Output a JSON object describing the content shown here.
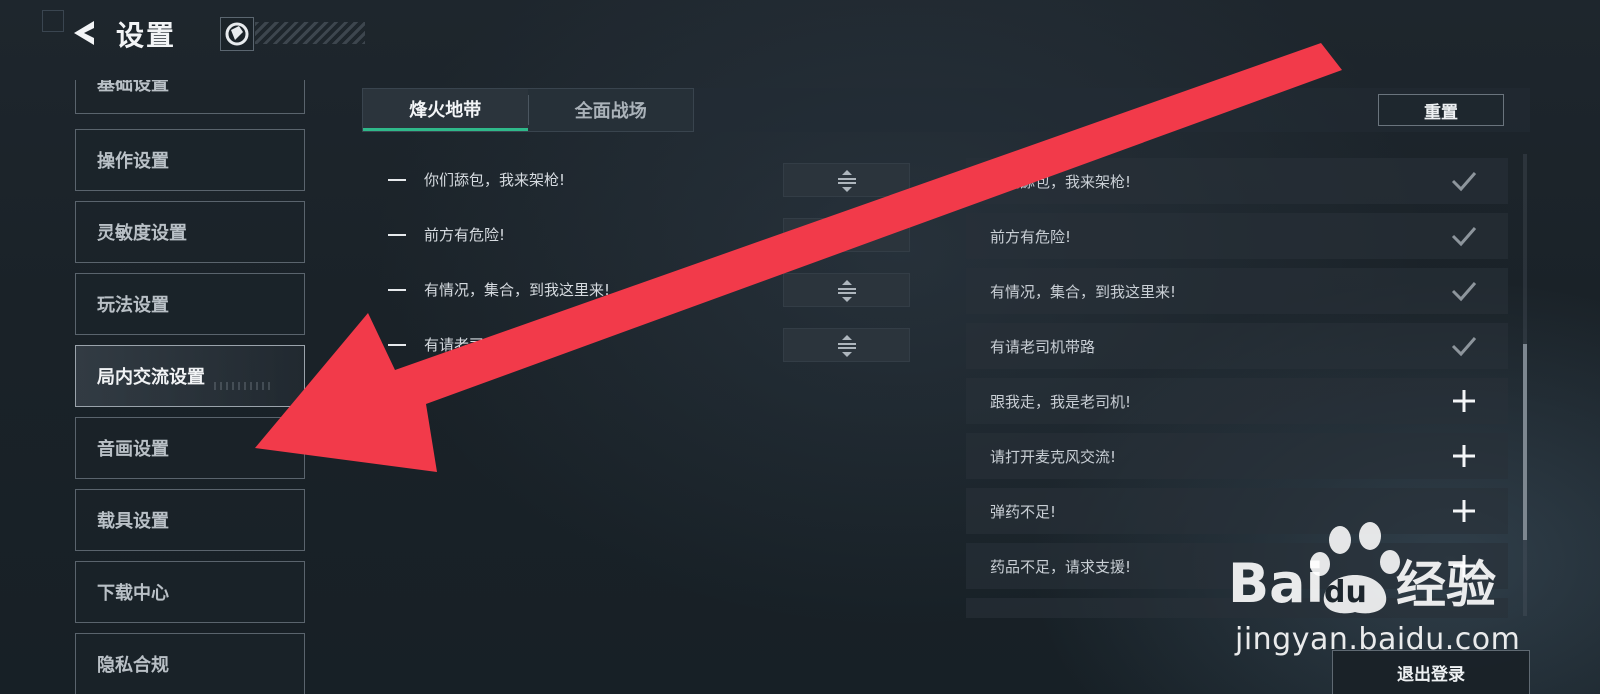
{
  "header": {
    "title": "设置",
    "icons": {
      "back": "back-arrow-icon",
      "logo": "game-logo-icon"
    }
  },
  "sidebar": {
    "items": [
      {
        "label": "基础设置"
      },
      {
        "label": "操作设置"
      },
      {
        "label": "灵敏度设置"
      },
      {
        "label": "玩法设置"
      },
      {
        "label": "局内交流设置",
        "active": true
      },
      {
        "label": "音画设置"
      },
      {
        "label": "载具设置"
      },
      {
        "label": "下载中心"
      },
      {
        "label": "隐私合规"
      }
    ]
  },
  "tabs": [
    {
      "label": "烽火地带",
      "active": true
    },
    {
      "label": "全面战场",
      "active": false
    }
  ],
  "toolbar": {
    "reset_label": "重置"
  },
  "selected_phrases": [
    {
      "text": "你们舔包，我来架枪!"
    },
    {
      "text": "前方有危险!"
    },
    {
      "text": "有情况，集合，到我这里来!"
    },
    {
      "text": "有请老司机带路"
    }
  ],
  "available_phrases": [
    {
      "text": "你们舔包，我来架枪!",
      "state": "added"
    },
    {
      "text": "前方有危险!",
      "state": "added"
    },
    {
      "text": "有情况，集合，到我这里来!",
      "state": "added"
    },
    {
      "text": "有请老司机带路",
      "state": "added"
    },
    {
      "text": "跟我走，我是老司机!",
      "state": "add"
    },
    {
      "text": "请打开麦克风交流!",
      "state": "add"
    },
    {
      "text": "弹药不足!",
      "state": "add"
    },
    {
      "text": "药品不足，请求支援!",
      "state": "add"
    },
    {
      "text": "",
      "state": "add"
    }
  ],
  "footer": {
    "logout_label": "退出登录"
  },
  "watermark": {
    "brand": "Baidu经验",
    "url": "jingyan.baidu.com"
  },
  "colors": {
    "accent_tab": "#2fb98a",
    "annotation_arrow": "#f23a4a"
  }
}
